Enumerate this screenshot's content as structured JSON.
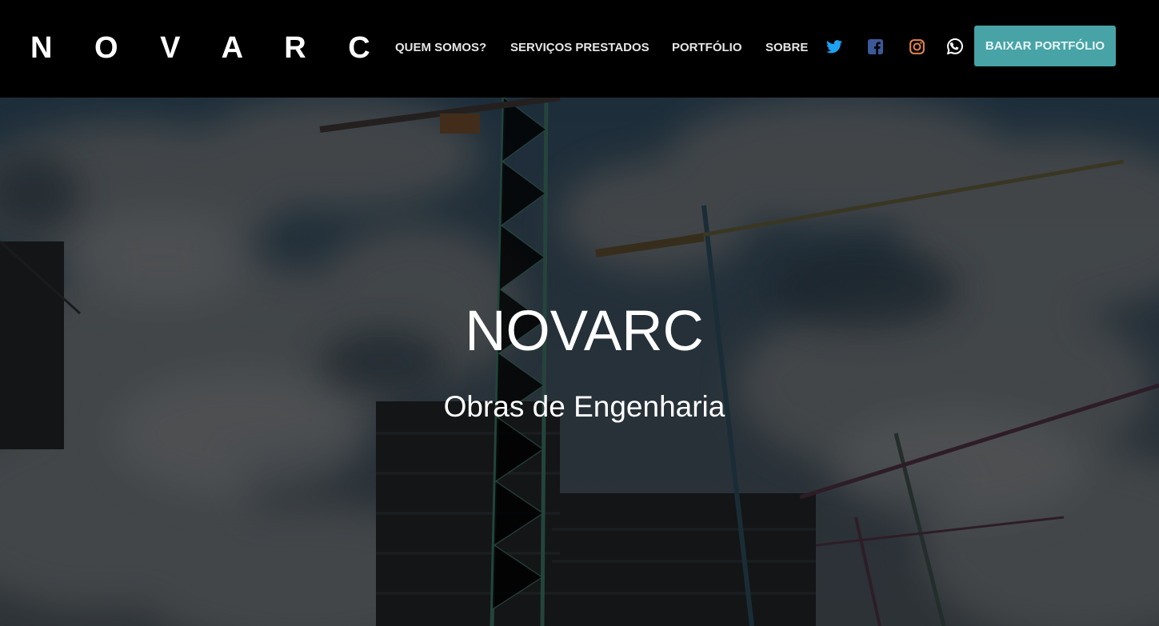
{
  "header": {
    "logo": "N O V A R C",
    "nav": [
      {
        "label": "QUEM SOMOS?"
      },
      {
        "label": "SERVIÇOS PRESTADOS"
      },
      {
        "label": "PORTFÓLIO"
      },
      {
        "label": "SOBRE"
      }
    ],
    "social": [
      {
        "icon": "twitter-icon",
        "color": "#1da1f2"
      },
      {
        "icon": "facebook-icon",
        "color": "#3b5998"
      },
      {
        "icon": "instagram-icon",
        "color": "#e0824f"
      },
      {
        "icon": "whatsapp-icon",
        "color": "#ffffff"
      }
    ],
    "download_label": "BAIXAR PORTFÓLIO",
    "accent_color": "#47a3a6"
  },
  "hero": {
    "title": "NOVARC",
    "subtitle": "Obras de Engenharia"
  }
}
